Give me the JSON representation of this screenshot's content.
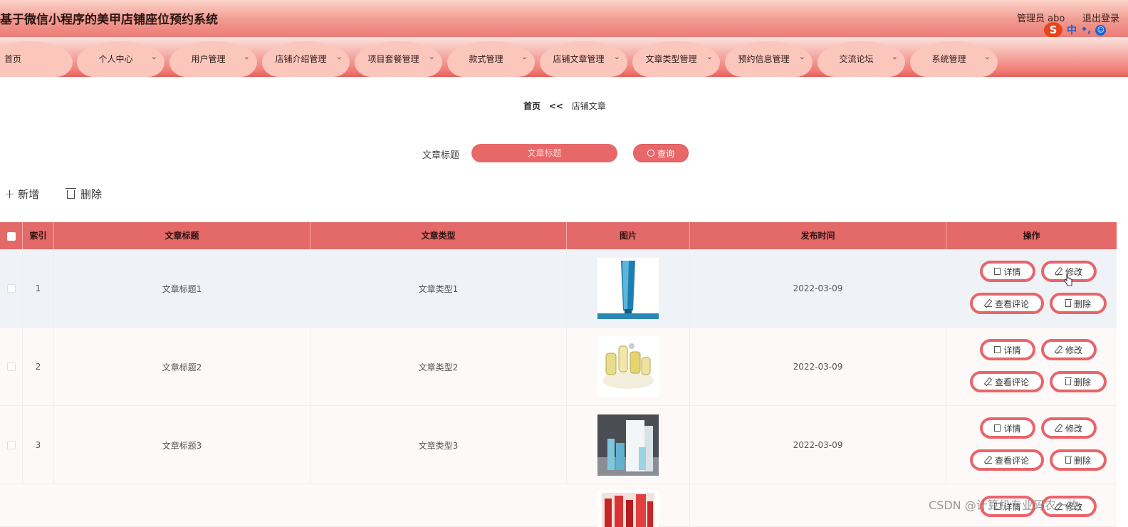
{
  "header": {
    "title": "基于微信小程序的美甲店铺座位预约系统",
    "admin": "管理员 abo",
    "logout": "退出登录",
    "ime": {
      "logo": "S",
      "mode": "中",
      "punct": "•,",
      "emoji": "☺"
    }
  },
  "nav": [
    {
      "label": "首页",
      "has_dropdown": false
    },
    {
      "label": "个人中心",
      "has_dropdown": true
    },
    {
      "label": "用户管理",
      "has_dropdown": true
    },
    {
      "label": "店铺介绍管理",
      "has_dropdown": true
    },
    {
      "label": "项目套餐管理",
      "has_dropdown": true
    },
    {
      "label": "款式管理",
      "has_dropdown": true
    },
    {
      "label": "店铺文章管理",
      "has_dropdown": true
    },
    {
      "label": "文章类型管理",
      "has_dropdown": true
    },
    {
      "label": "预约信息管理",
      "has_dropdown": true
    },
    {
      "label": "交流论坛",
      "has_dropdown": true
    },
    {
      "label": "系统管理",
      "has_dropdown": true
    }
  ],
  "breadcrumb": {
    "home": "首页",
    "sep": "<<",
    "current": "店铺文章"
  },
  "search": {
    "label": "文章标题",
    "placeholder": "文章标题",
    "button": "查询"
  },
  "toolbar": {
    "add": "新增",
    "delete": "删除"
  },
  "table": {
    "columns": [
      "索引",
      "文章标题",
      "文章类型",
      "图片",
      "发布时间",
      "操作"
    ],
    "rows": [
      {
        "index": "1",
        "title": "文章标题1",
        "type": "文章类型1",
        "image": "blue-tube-product",
        "date": "2022-03-09"
      },
      {
        "index": "2",
        "title": "文章标题2",
        "type": "文章类型2",
        "image": "perfume-bottles",
        "date": "2022-03-09"
      },
      {
        "index": "3",
        "title": "文章标题3",
        "type": "文章类型3",
        "image": "skincare-set",
        "date": "2022-03-09"
      }
    ],
    "actions": {
      "detail": "详情",
      "edit": "修改",
      "comments": "查看评论",
      "delete": "删除"
    },
    "partial_row_actions": {
      "detail": "详情",
      "edit": "修改"
    }
  },
  "watermark": "CSDN @计算机专业码农一枚"
}
